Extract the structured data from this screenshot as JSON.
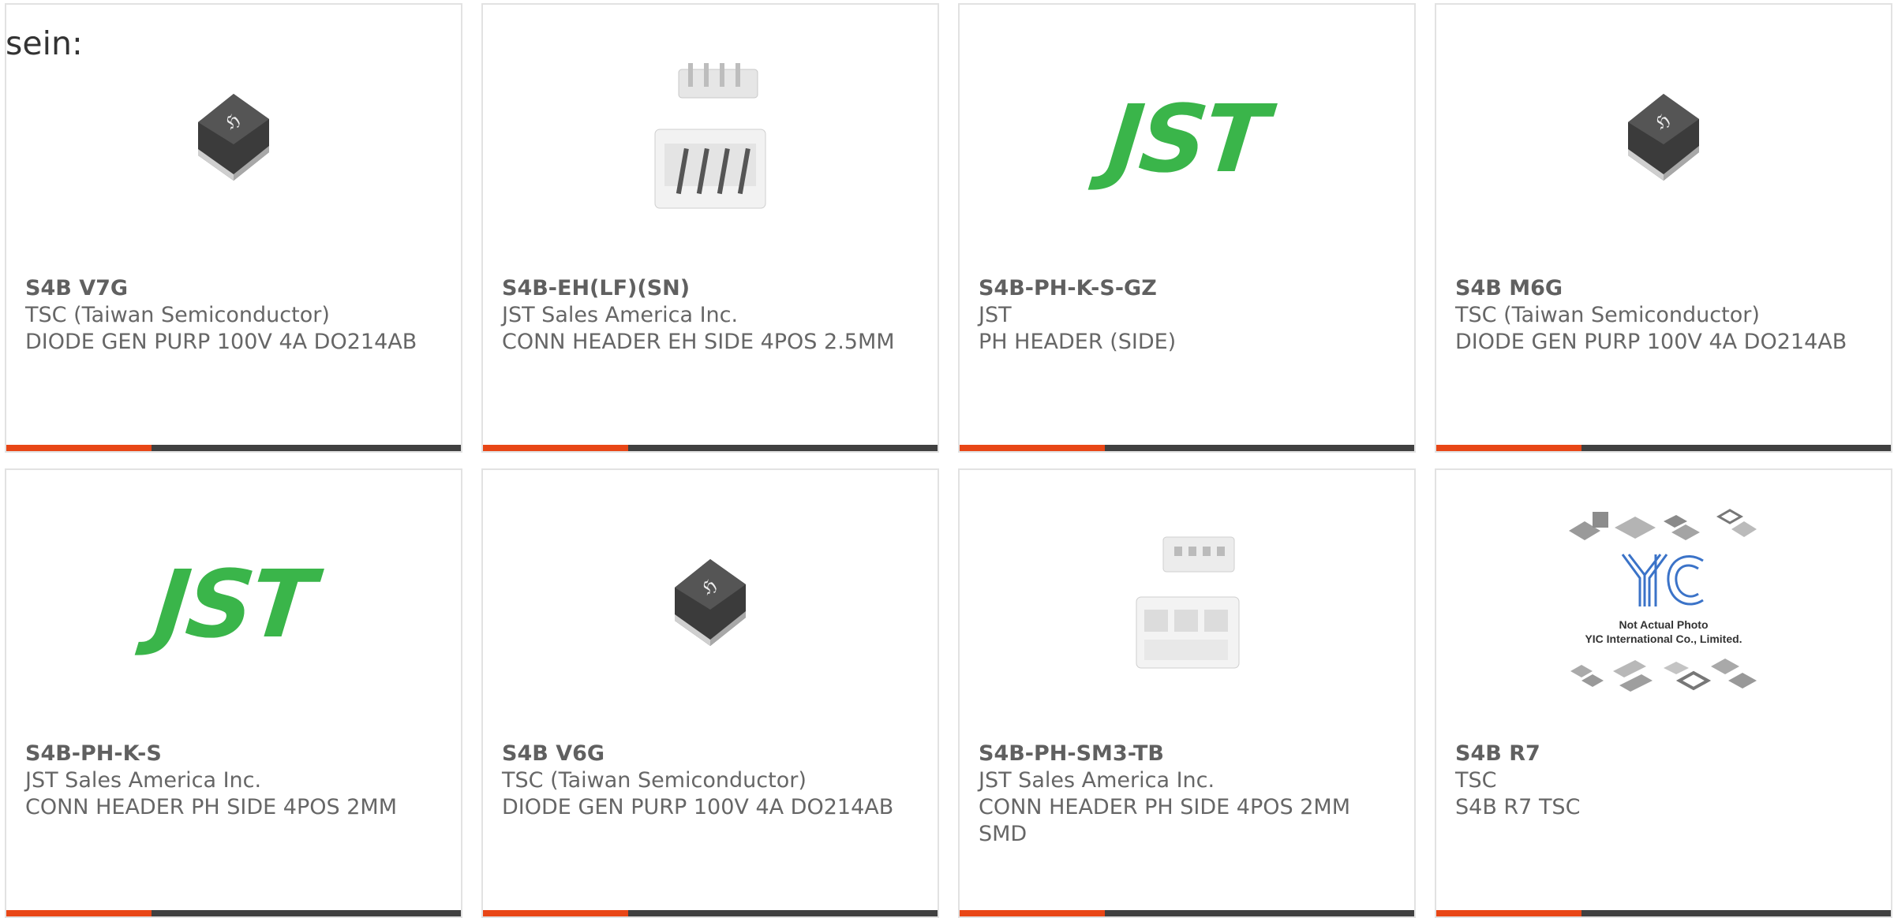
{
  "leading_text": "sein:",
  "colors": {
    "accent": "#e84616",
    "bar": "#404040",
    "jst_green": "#3ab54a",
    "border": "#e2e2e2"
  },
  "products": [
    {
      "part": "S4B V7G",
      "manufacturer": "TSC (Taiwan Semiconductor)",
      "description": "DIODE GEN PURP 100V 4A DO214AB",
      "image": "smd-diode"
    },
    {
      "part": "S4B-EH(LF)(SN)",
      "manufacturer": "JST Sales America Inc.",
      "description": "CONN HEADER EH SIDE 4POS 2.5MM",
      "image": "connector-header"
    },
    {
      "part": "S4B-PH-K-S-GZ",
      "manufacturer": "JST",
      "description": "PH HEADER (SIDE)",
      "image": "jst-logo",
      "logo_text": "JST"
    },
    {
      "part": "S4B M6G",
      "manufacturer": "TSC (Taiwan Semiconductor)",
      "description": "DIODE GEN PURP 100V 4A DO214AB",
      "image": "smd-diode"
    },
    {
      "part": "S4B-PH-K-S",
      "manufacturer": "JST Sales America Inc.",
      "description": "CONN HEADER PH SIDE 4POS 2MM",
      "image": "jst-logo",
      "logo_text": "JST"
    },
    {
      "part": "S4B V6G",
      "manufacturer": "TSC (Taiwan Semiconductor)",
      "description": "DIODE GEN PURP 100V 4A DO214AB",
      "image": "smd-diode"
    },
    {
      "part": "S4B-PH-SM3-TB",
      "manufacturer": "JST Sales America Inc.",
      "description": "CONN HEADER PH SIDE 4POS 2MM SMD",
      "image": "connector-header"
    },
    {
      "part": "S4B R7",
      "manufacturer": "TSC",
      "description": "S4B R7 TSC",
      "image": "placeholder-photo",
      "placeholder_lines": [
        "Not Actual Photo",
        "YIC International Co., Limited."
      ]
    }
  ]
}
